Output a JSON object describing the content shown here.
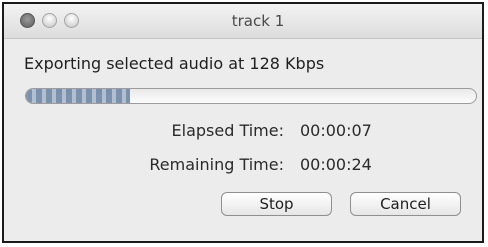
{
  "window": {
    "title": "track 1"
  },
  "export": {
    "status": "Exporting selected audio at 128 Kbps",
    "progress_fraction": 0.23,
    "elapsed_label": "Elapsed Time:",
    "elapsed_value": "00:00:07",
    "remaining_label": "Remaining Time:",
    "remaining_value": "00:00:24"
  },
  "buttons": {
    "stop_label": "Stop",
    "cancel_label": "Cancel"
  },
  "colors": {
    "window_background": "#ececec",
    "progress_accent": "#6f86a6"
  }
}
